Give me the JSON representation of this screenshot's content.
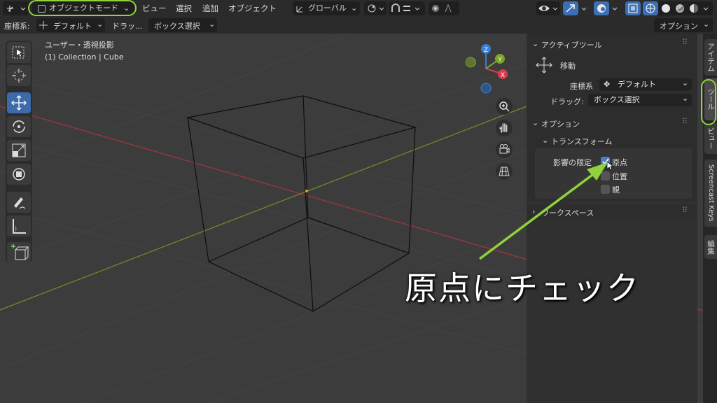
{
  "header": {
    "mode_label": "オブジェクトモード",
    "menus": [
      "ビュー",
      "選択",
      "追加",
      "オブジェクト"
    ],
    "transform_orientation": "グローバル"
  },
  "tool_settings": {
    "orientation_label": "座標系:",
    "orientation_value": "デフォルト",
    "drag_label": "ドラッ...",
    "drag_value": "ボックス選択",
    "options_label": "オプション"
  },
  "viewport": {
    "view_name": "ユーザー・透視投影",
    "collection_info": "(1) Collection | Cube",
    "gizmo_axes": {
      "x": "X",
      "y": "Y",
      "z": "Z"
    }
  },
  "npanel": {
    "active_tool_header": "アクティブツール",
    "tool_name": "移動",
    "orientation_label": "座標系",
    "orientation_value": "デフォルト",
    "drag_label": "ドラッグ:",
    "drag_value": "ボックス選択",
    "options_header": "オプション",
    "transform_header": "トランスフォーム",
    "affect_only_label": "影響の限定",
    "checkboxes": [
      {
        "label": "原点",
        "checked": true
      },
      {
        "label": "位置",
        "checked": false
      },
      {
        "label": "親",
        "checked": false
      }
    ],
    "workspace_header": "ワークスペース"
  },
  "side_tabs": [
    "アイテム",
    "ツール",
    "ビュー",
    "Screencast Keys",
    "編集"
  ],
  "annotation": "原点にチェック",
  "colors": {
    "accent": "#3c6fb5",
    "highlight_green": "#8fd33a",
    "axis_red": "#a0343f",
    "axis_green": "#6f8a2c"
  }
}
